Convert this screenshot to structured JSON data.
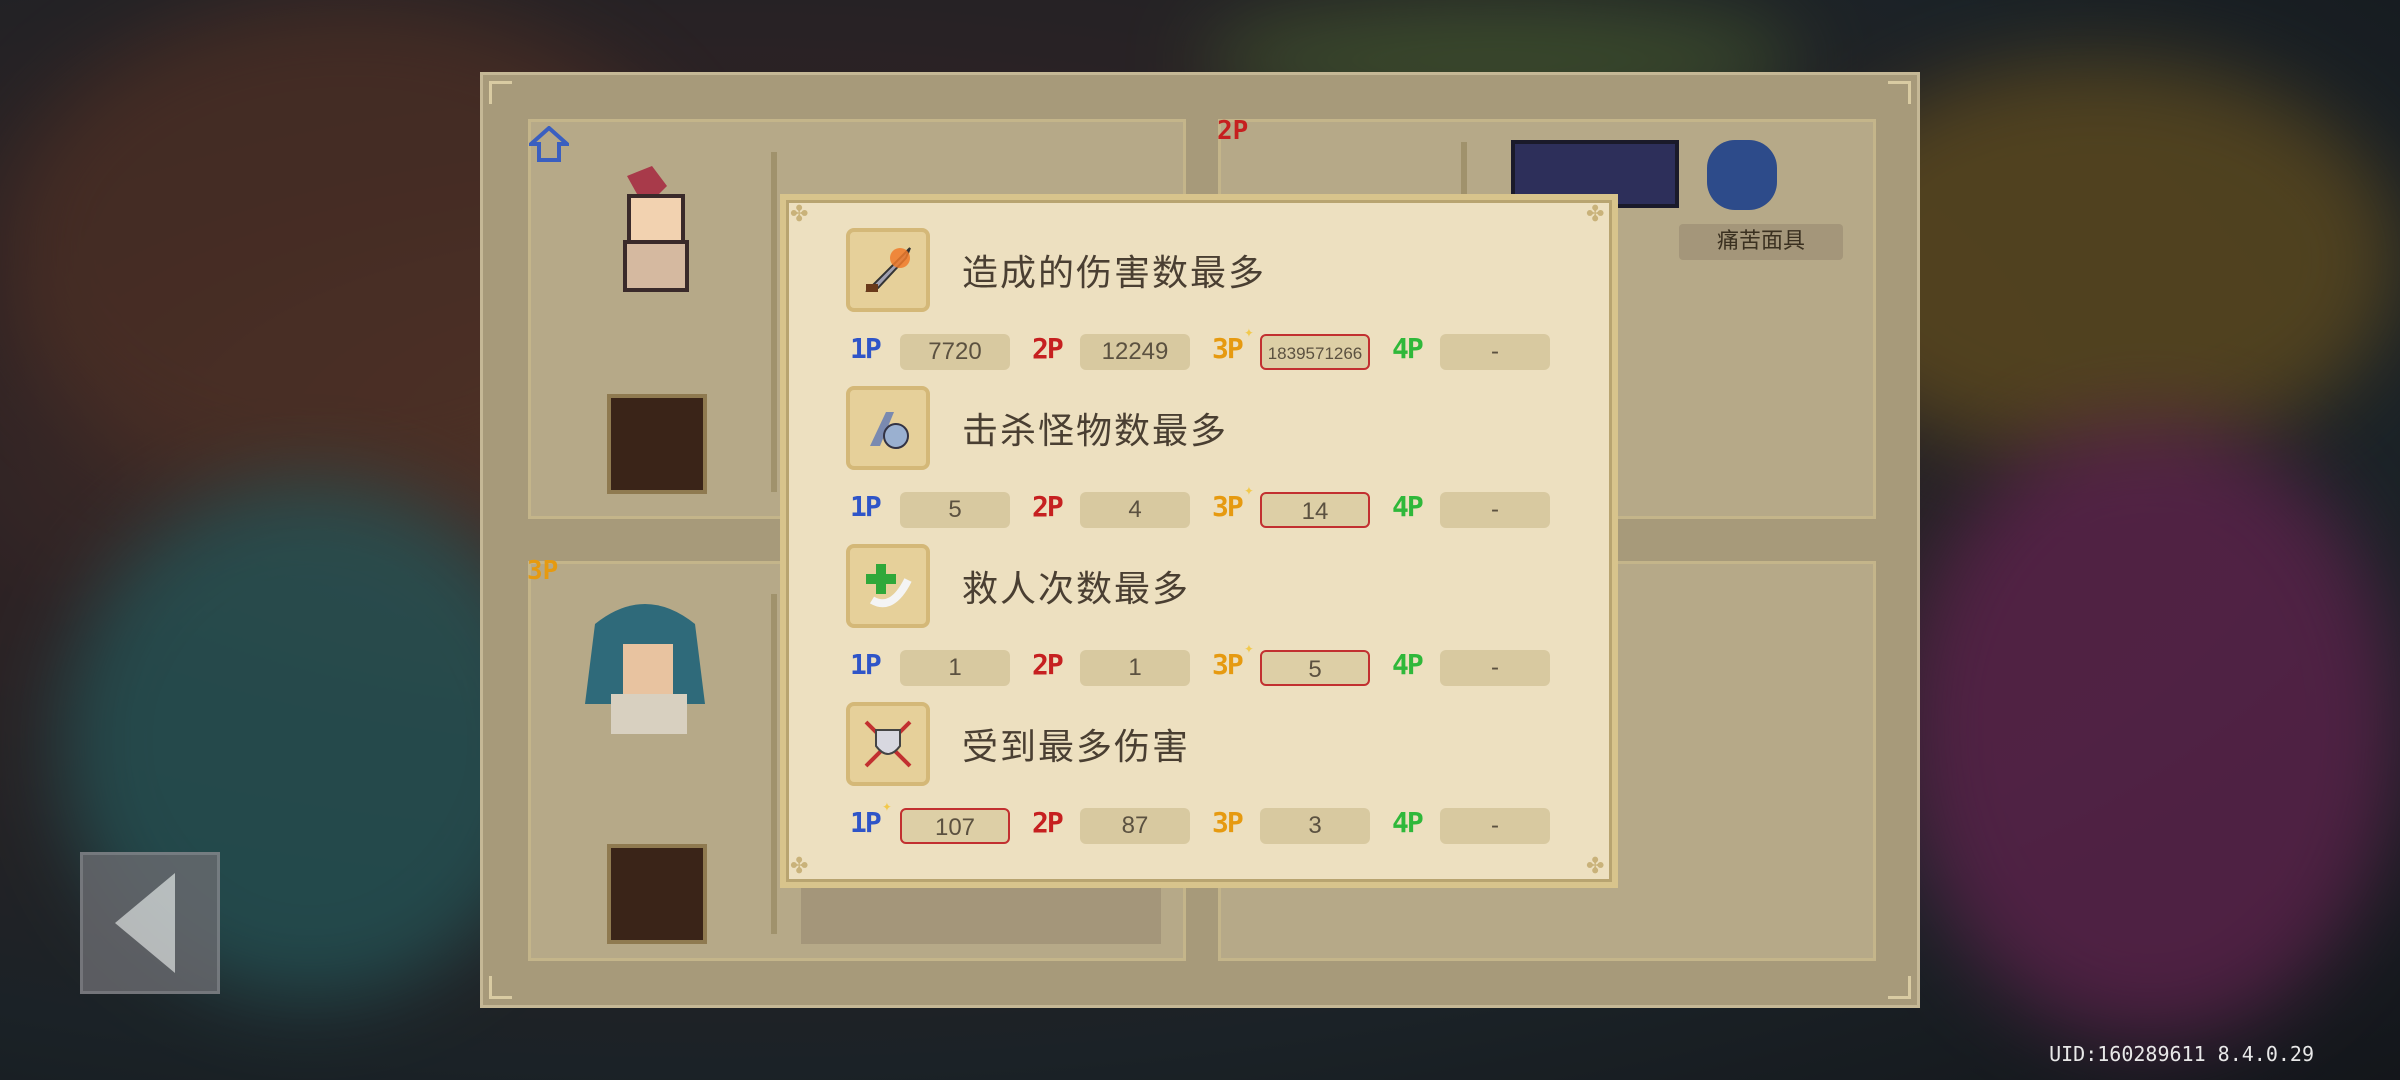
{
  "background": {
    "accent": "#ede0c0"
  },
  "cards": {
    "card2_label": "2P",
    "card3_label": "3P",
    "item_label_1": "痛苦面具"
  },
  "uid_text": "UID:160289611 8.4.0.29",
  "icons": {
    "back": "back-arrow-icon",
    "damage": "flaming-sword-icon",
    "kills": "monster-kill-icon",
    "revives": "heal-plus-icon",
    "damage_taken": "shield-hit-icon"
  },
  "players": [
    "1P",
    "2P",
    "3P",
    "4P"
  ],
  "stats": [
    {
      "title": "造成的伤害数最多",
      "values": [
        "7720",
        "12249",
        "1839571266",
        "-"
      ],
      "best": "3P"
    },
    {
      "title": "击杀怪物数最多",
      "values": [
        "5",
        "4",
        "14",
        "-"
      ],
      "best": "3P"
    },
    {
      "title": "救人次数最多",
      "values": [
        "1",
        "1",
        "5",
        "-"
      ],
      "best": "3P"
    },
    {
      "title": "受到最多伤害",
      "values": [
        "107",
        "87",
        "3",
        "-"
      ],
      "best": "1P"
    }
  ]
}
